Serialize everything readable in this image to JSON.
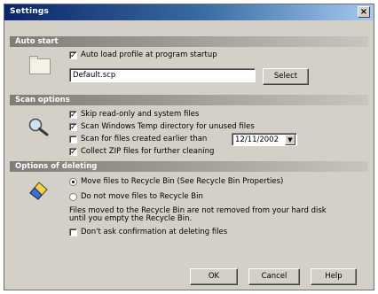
{
  "window": {
    "title": "Settings",
    "close_glyph": "×"
  },
  "auto_start": {
    "header": "Auto start",
    "autoload_label": "Auto load profile at program startup",
    "autoload_checked": true,
    "profile_value": "Default.scp",
    "select_label": "Select"
  },
  "scan_options": {
    "header": "Scan options",
    "skip_readonly_label": "Skip read-only and system files",
    "scan_temp_label": "Scan Windows Temp directory for unused files",
    "scan_older_label": "Scan for files created earlier than",
    "collect_zip_label": "Collect ZIP files for further cleaning",
    "date_value": "12/11/2002",
    "dropdown_glyph": "▼"
  },
  "deleting": {
    "header": "Options of deleting",
    "move_recycle_label": "Move files to Recycle Bin (See Recycle Bin Properties)",
    "no_move_label": "Do not move files to Recycle Bin",
    "note_line1": "Files moved to the Recycle Bin are not removed from your hard disk",
    "note_line2": "until you empty the Recycle Bin.",
    "dont_ask_label": "Don't ask confirmation at deleting files"
  },
  "footer": {
    "ok_label": "OK",
    "cancel_label": "Cancel",
    "help_label": "Help"
  },
  "colors": {
    "title_active": "#0a246a",
    "face": "#d4d0c8",
    "group_header": "#8c8a84"
  },
  "icons": [
    "folder-icon",
    "magnifier-icon",
    "eraser-icon",
    "close-icon",
    "dropdown-arrow-icon"
  ]
}
